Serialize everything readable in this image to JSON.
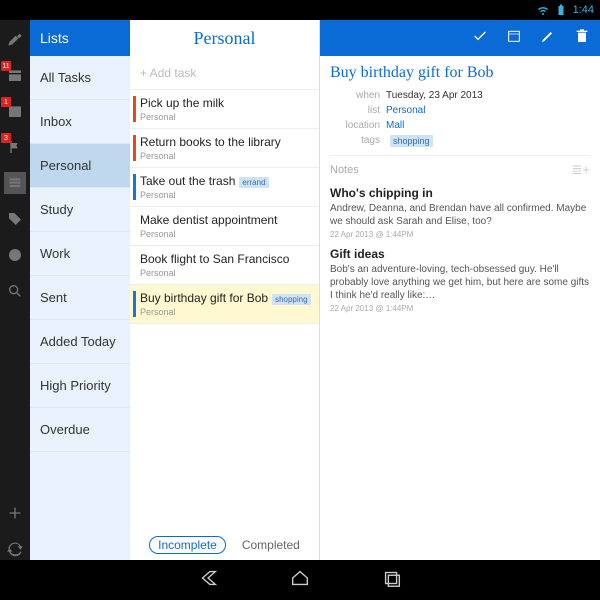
{
  "status": {
    "time": "1:44"
  },
  "toolbar": {
    "badges": {
      "cal": "11",
      "inbox": "1",
      "flag": "3"
    }
  },
  "lists": {
    "header": "Lists",
    "items": [
      {
        "label": "All Tasks"
      },
      {
        "label": "Inbox"
      },
      {
        "label": "Personal",
        "selected": true
      },
      {
        "label": "Study"
      },
      {
        "label": "Work"
      },
      {
        "label": "Sent"
      },
      {
        "label": "Added Today"
      },
      {
        "label": "High Priority"
      },
      {
        "label": "Overdue"
      }
    ]
  },
  "tasklist": {
    "title": "Personal",
    "add_placeholder": "+ Add task",
    "filters": {
      "incomplete": "Incomplete",
      "completed": "Completed"
    },
    "tasks": [
      {
        "title": "Pick up the milk",
        "sub": "Personal",
        "color": "red"
      },
      {
        "title": "Return books to the library",
        "sub": "Personal",
        "color": "red"
      },
      {
        "title": "Take out the trash",
        "sub": "Personal",
        "color": "blue",
        "tag": "errand"
      },
      {
        "title": "Make dentist appointment",
        "sub": "Personal",
        "color": ""
      },
      {
        "title": "Book flight to San Francisco",
        "sub": "Personal",
        "color": ""
      },
      {
        "title": "Buy birthday gift for Bob",
        "sub": "Personal",
        "color": "blue",
        "tag": "shopping",
        "selected": true
      }
    ]
  },
  "detail": {
    "title": "Buy birthday gift for Bob",
    "meta": {
      "when_k": "when",
      "when_v": "Tuesday, 23 Apr 2013",
      "list_k": "list",
      "list_v": "Personal",
      "loc_k": "location",
      "loc_v": "Mall",
      "tags_k": "tags",
      "tags_v": "shopping"
    },
    "notes_label": "Notes",
    "notes": [
      {
        "title": "Who's chipping in",
        "text": "Andrew, Deanna, and Brendan have all confirmed. Maybe we should ask Sarah and Elise, too?",
        "time": "22 Apr 2013 @ 1:44PM"
      },
      {
        "title": "Gift ideas",
        "text": "Bob's an adventure-loving, tech-obsessed guy. He'll probably love anything we get him, but here are some gifts I think he'd really like:…",
        "time": "22 Apr 2013 @ 1:44PM"
      }
    ]
  }
}
